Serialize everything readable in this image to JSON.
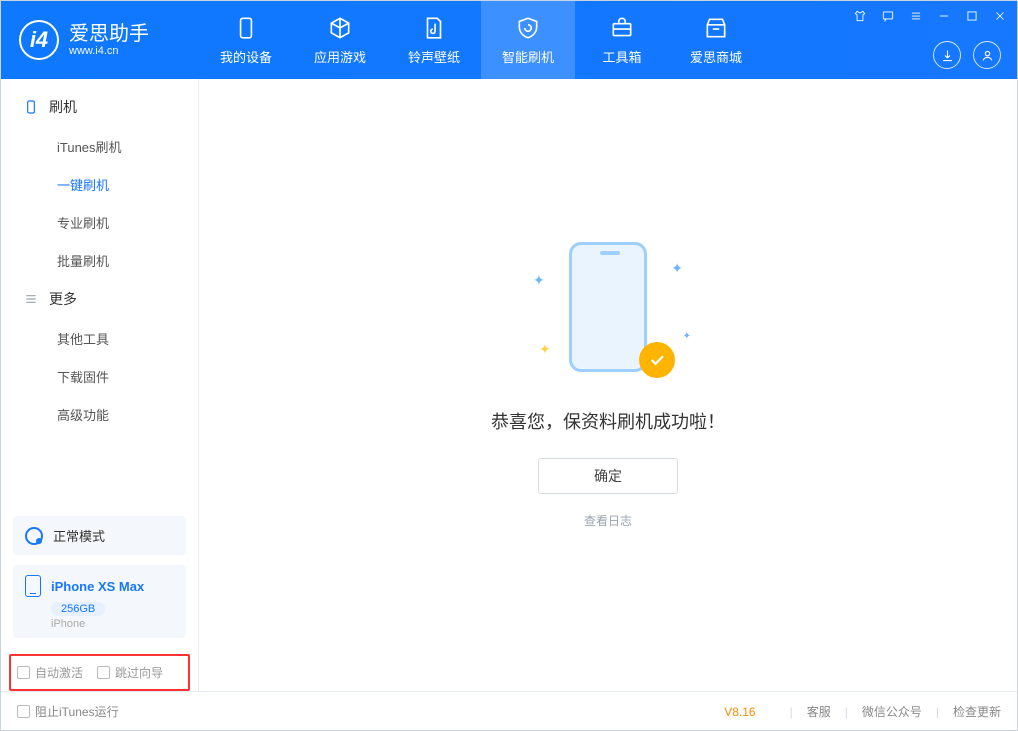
{
  "app": {
    "title": "爱思助手",
    "subtitle": "www.i4.cn"
  },
  "nav": {
    "items": [
      {
        "label": "我的设备"
      },
      {
        "label": "应用游戏"
      },
      {
        "label": "铃声壁纸"
      },
      {
        "label": "智能刷机"
      },
      {
        "label": "工具箱"
      },
      {
        "label": "爱思商城"
      }
    ]
  },
  "sidebar": {
    "group_flash": "刷机",
    "flash_items": [
      {
        "label": "iTunes刷机"
      },
      {
        "label": "一键刷机"
      },
      {
        "label": "专业刷机"
      },
      {
        "label": "批量刷机"
      }
    ],
    "group_more": "更多",
    "more_items": [
      {
        "label": "其他工具"
      },
      {
        "label": "下载固件"
      },
      {
        "label": "高级功能"
      }
    ],
    "mode": "正常模式",
    "device": {
      "name": "iPhone XS Max",
      "storage": "256GB",
      "type": "iPhone"
    },
    "checkboxes": {
      "auto_activate": "自动激活",
      "skip_guide": "跳过向导"
    }
  },
  "main": {
    "message": "恭喜您，保资料刷机成功啦！",
    "ok": "确定",
    "view_log": "查看日志"
  },
  "footer": {
    "block_itunes": "阻止iTunes运行",
    "version": "V8.16",
    "support": "客服",
    "wechat": "微信公众号",
    "update": "检查更新"
  }
}
